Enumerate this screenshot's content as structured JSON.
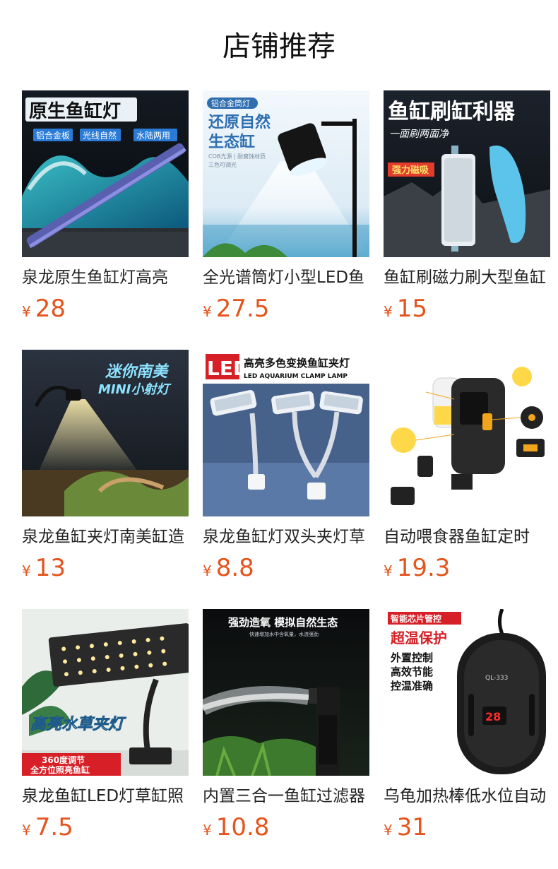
{
  "section_title": "店铺推荐",
  "currency": "¥",
  "products": [
    {
      "name": "泉龙原生鱼缸灯高亮",
      "price": "28",
      "image": {
        "headline": "原生鱼缸灯",
        "tags": [
          "铝合金板",
          "光线自然",
          "水陆两用"
        ]
      }
    },
    {
      "name": "全光谱筒灯小型LED鱼",
      "price": "27.5",
      "image": {
        "badge": "铝合金筒灯",
        "headline_line1": "还原自然",
        "headline_line2": "生态缸",
        "fine_print_1": "COB光源 | 耐腐蚀材质",
        "fine_print_2": "三色可调光"
      }
    },
    {
      "name": "鱼缸刷磁力刷大型鱼缸",
      "price": "15",
      "image": {
        "headline": "鱼缸刷缸利器",
        "subline": "一面刷两面净",
        "badge": "强力磁吸"
      }
    },
    {
      "name": "泉龙鱼缸夹灯南美缸造",
      "price": "13",
      "image": {
        "headline_line1": "迷你南美",
        "headline_line2": "MINI小射灯"
      }
    },
    {
      "name": "泉龙鱼缸灯双头夹灯草",
      "price": "8.8",
      "image": {
        "logo": "LED",
        "headline": "高亮多色变换鱼缸夹灯",
        "subline": "LED AQUARIUM CLAMP LAMP"
      }
    },
    {
      "name": "自动喂食器鱼缸定时",
      "price": "19.3",
      "image": {}
    },
    {
      "name": "泉龙鱼缸LED灯草缸照",
      "price": "7.5",
      "image": {
        "headline": "高亮水草夹灯",
        "banner_line1": "360度调节",
        "banner_line2": "全方位照亮鱼缸"
      }
    },
    {
      "name": "内置三合一鱼缸过滤器",
      "price": "10.8",
      "image": {
        "headline": "强劲造氧 模拟自然生态",
        "subline": "快速增加水中含氧量，水流强劲"
      }
    },
    {
      "name": "乌龟加热棒低水位自动",
      "price": "31",
      "image": {
        "badge": "智能芯片管控",
        "headline": "超温保护",
        "line1": "外置控制",
        "line2": "高效节能",
        "line3": "控温准确",
        "model": "QL-333",
        "display": "28"
      }
    }
  ]
}
